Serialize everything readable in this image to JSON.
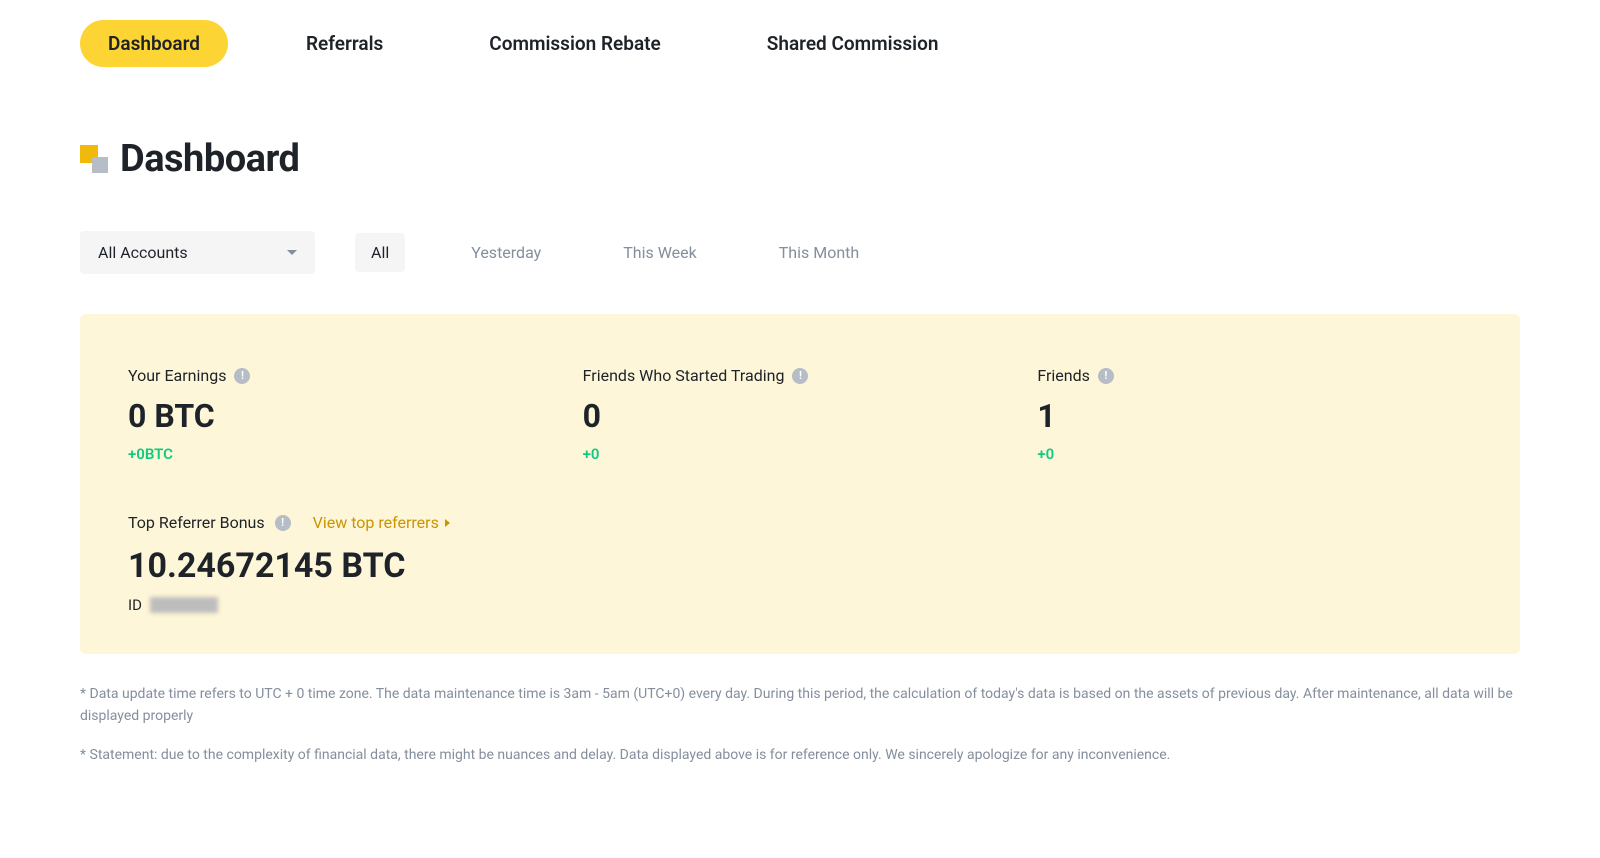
{
  "tabs": [
    {
      "label": "Dashboard",
      "active": true
    },
    {
      "label": "Referrals",
      "active": false
    },
    {
      "label": "Commission Rebate",
      "active": false
    },
    {
      "label": "Shared Commission",
      "active": false
    }
  ],
  "page_title": "Dashboard",
  "account_select": {
    "value": "All Accounts"
  },
  "range_tabs": [
    {
      "label": "All",
      "active": true
    },
    {
      "label": "Yesterday",
      "active": false
    },
    {
      "label": "This Week",
      "active": false
    },
    {
      "label": "This Month",
      "active": false
    }
  ],
  "stats": {
    "earnings": {
      "label": "Your Earnings",
      "value": "0 BTC",
      "delta": "+0BTC"
    },
    "friends_trading": {
      "label": "Friends Who Started Trading",
      "value": "0",
      "delta": "+0"
    },
    "friends": {
      "label": "Friends",
      "value": "1",
      "delta": "+0"
    }
  },
  "bonus": {
    "label": "Top Referrer Bonus",
    "link": "View top referrers",
    "value": "10.24672145 BTC",
    "id_label": "ID"
  },
  "disclaimers": {
    "line1": "* Data update time refers to UTC + 0 time zone. The data maintenance time is 3am - 5am (UTC+0) every day. During this period, the calculation of today's data is based on the assets of previous day. After maintenance, all data will be displayed properly",
    "line2": "* Statement: due to the complexity of financial data, there might be nuances and delay. Data displayed above is for reference only. We sincerely apologize for any inconvenience."
  }
}
